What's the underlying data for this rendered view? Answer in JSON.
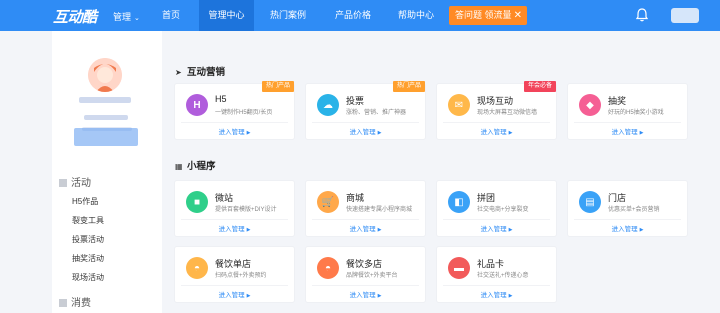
{
  "header": {
    "logo": "互动酷",
    "manage": "管理",
    "nav": [
      "首页",
      "管理中心",
      "热门案例",
      "产品价格",
      "帮助中心"
    ],
    "active_nav": "管理中心",
    "promo": "答问题 领流量"
  },
  "sidebar": {
    "section1": "活动",
    "items": [
      "H5作品",
      "裂变工具",
      "投票活动",
      "抽奖活动",
      "现场活动"
    ],
    "section2": "消费"
  },
  "main": {
    "section1_title": "互动营销",
    "section2_title": "小程序",
    "enter_label": "进入管理",
    "marketing": [
      {
        "name": "H5",
        "desc": "一键制作H5翻页/长页",
        "badge": "热门产品",
        "badge_color": "#ffa02e",
        "icon_color": "#b05ddc",
        "icon_glyph": "H"
      },
      {
        "name": "投票",
        "desc": "涨粉、营销、推广神器",
        "badge": "热门产品",
        "badge_color": "#ffa02e",
        "icon_color": "#2ab3e8",
        "icon_glyph": "☁"
      },
      {
        "name": "现场互动",
        "desc": "现场大屏幕互动微信墙",
        "badge": "年会必备",
        "badge_color": "#f2445b",
        "icon_color": "#ffb84a",
        "icon_glyph": "✉"
      },
      {
        "name": "抽奖",
        "desc": "好玩的H5抽奖小游戏",
        "badge": "",
        "badge_color": "",
        "icon_color": "#f55f94",
        "icon_glyph": "◆"
      }
    ],
    "miniprograms": [
      {
        "name": "微站",
        "desc": "提供百套模版+DIY设计",
        "icon_color": "#2fcf8a",
        "icon_glyph": "■"
      },
      {
        "name": "商城",
        "desc": "快速搭建专属小程序商城",
        "icon_color": "#ffa84a",
        "icon_glyph": "🛒"
      },
      {
        "name": "拼团",
        "desc": "社交电商+分享裂变",
        "icon_color": "#3aa2f7",
        "icon_glyph": "◧"
      },
      {
        "name": "门店",
        "desc": "优惠买单+会员营销",
        "icon_color": "#3aa2f7",
        "icon_glyph": "▤"
      },
      {
        "name": "餐饮单店",
        "desc": "扫码点餐+外卖预约",
        "icon_color": "#ffb64a",
        "icon_glyph": "◓"
      },
      {
        "name": "餐饮多店",
        "desc": "品牌餐饮+外卖平台",
        "icon_color": "#ff7a4a",
        "icon_glyph": "◓"
      },
      {
        "name": "礼品卡",
        "desc": "社交送礼+传递心意",
        "icon_color": "#f25a5a",
        "icon_glyph": "▬"
      }
    ]
  }
}
